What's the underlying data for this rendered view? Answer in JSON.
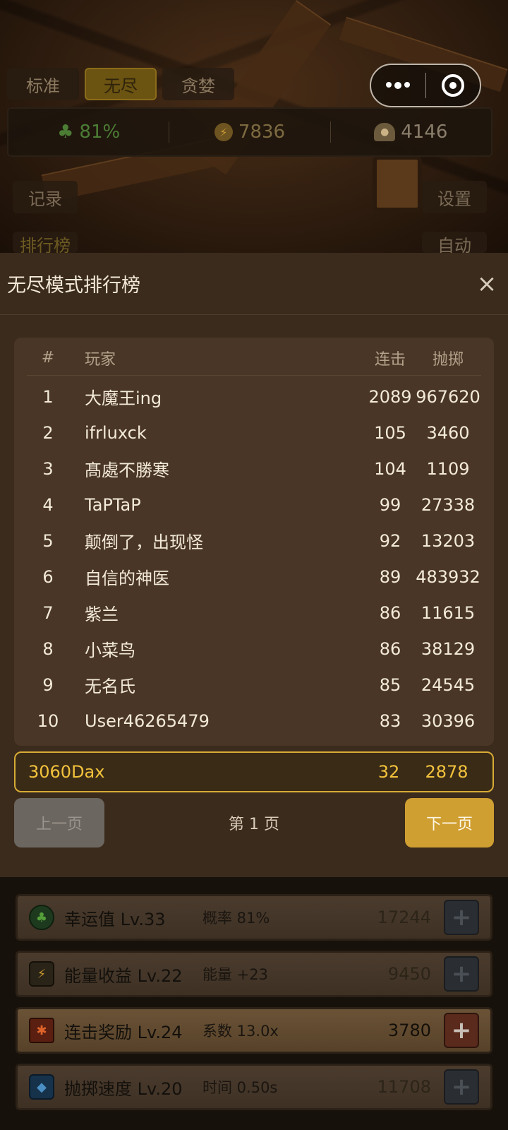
{
  "top": {
    "mode_tabs": [
      {
        "label": "标准",
        "active": false
      },
      {
        "label": "无尽",
        "active": true
      },
      {
        "label": "贪婪",
        "active": false
      }
    ],
    "stats": {
      "luck": "81%",
      "energy": "7836",
      "coins": "4146"
    },
    "record_label": "记录",
    "settings_label": "设置",
    "rank_label": "排行榜",
    "auto_label": "自动"
  },
  "capsule": {
    "more_icon": "more-dots-icon",
    "close_icon": "target-circle-icon"
  },
  "modal": {
    "title": "无尽模式排行榜",
    "close_glyph": "×",
    "columns": {
      "rank": "#",
      "player": "玩家",
      "combo": "连击",
      "throw": "抛掷"
    },
    "rows": [
      {
        "rank": "1",
        "name": "大魔王ing",
        "combo": "2089",
        "throw": "967620"
      },
      {
        "rank": "2",
        "name": "ifrluxck",
        "combo": "105",
        "throw": "3460"
      },
      {
        "rank": "3",
        "name": "髙處不勝寒",
        "combo": "104",
        "throw": "1109"
      },
      {
        "rank": "4",
        "name": "TaPTaP",
        "combo": "99",
        "throw": "27338"
      },
      {
        "rank": "5",
        "name": "颠倒了，出现怪",
        "combo": "92",
        "throw": "13203"
      },
      {
        "rank": "6",
        "name": "自信的神医",
        "combo": "89",
        "throw": "483932"
      },
      {
        "rank": "7",
        "name": "紫兰",
        "combo": "86",
        "throw": "11615"
      },
      {
        "rank": "8",
        "name": "小菜鸟",
        "combo": "86",
        "throw": "38129"
      },
      {
        "rank": "9",
        "name": "无名氏",
        "combo": "85",
        "throw": "24545"
      },
      {
        "rank": "10",
        "name": "User46265479",
        "combo": "83",
        "throw": "30396"
      }
    ],
    "me": {
      "name": "3060Dax",
      "combo": "32",
      "throw": "2878"
    },
    "prev_label": "上一页",
    "page_label": "第 1 页",
    "next_label": "下一页"
  },
  "upgrades": [
    {
      "name": "幸运值 Lv.33",
      "desc": "概率 81%",
      "cost": "17244",
      "icon": "clover-icon",
      "affordable": false
    },
    {
      "name": "能量收益 Lv.22",
      "desc": "能量 +23",
      "cost": "9450",
      "icon": "energy-shield-icon",
      "affordable": false
    },
    {
      "name": "连击奖励 Lv.24",
      "desc": "系数 13.0x",
      "cost": "3780",
      "icon": "combo-gem-icon",
      "affordable": true
    },
    {
      "name": "抛掷速度 Lv.20",
      "desc": "时间 0.50s",
      "cost": "11708",
      "icon": "speed-gem-icon",
      "affordable": false
    }
  ],
  "colors": {
    "accent": "#d09f32",
    "highlight_border": "#d7ab35",
    "luck_green": "#4c7d35"
  }
}
